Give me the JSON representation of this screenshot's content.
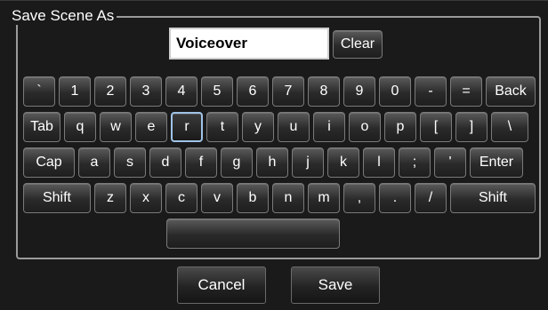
{
  "dialog": {
    "title": "Save Scene As",
    "name_value": "Voiceover",
    "clear_label": "Clear",
    "cancel_label": "Cancel",
    "save_label": "Save"
  },
  "keyboard": {
    "selected_key": "r",
    "rows": [
      [
        "`",
        "1",
        "2",
        "3",
        "4",
        "5",
        "6",
        "7",
        "8",
        "9",
        "0",
        "-",
        "=",
        "Back"
      ],
      [
        "Tab",
        "q",
        "w",
        "e",
        "r",
        "t",
        "y",
        "u",
        "i",
        "o",
        "p",
        "[",
        "]",
        "\\"
      ],
      [
        "Cap",
        "a",
        "s",
        "d",
        "f",
        "g",
        "h",
        "j",
        "k",
        "l",
        ";",
        "'",
        "Enter"
      ],
      [
        "Shift",
        "z",
        "x",
        "c",
        "v",
        "b",
        "n",
        "m",
        ",",
        ".",
        "/",
        "Shift"
      ],
      [
        ""
      ]
    ]
  }
}
